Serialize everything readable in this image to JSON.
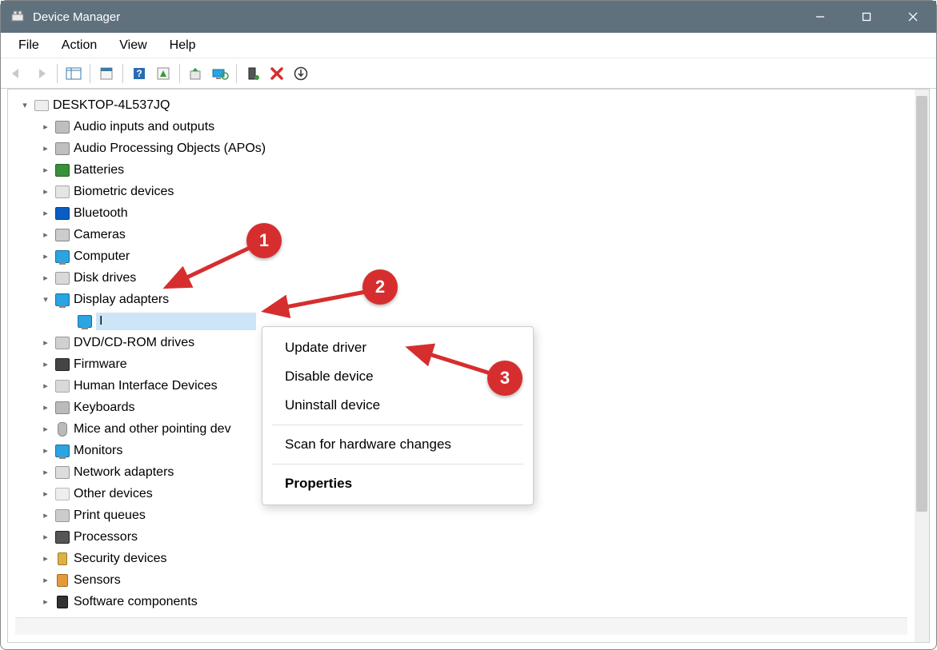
{
  "window": {
    "title": "Device Manager"
  },
  "menu": {
    "file": "File",
    "action": "Action",
    "view": "View",
    "help": "Help"
  },
  "toolbar": {
    "back": "Back",
    "forward": "Forward",
    "show_hide_tree": "Show/Hide Console Tree",
    "properties": "Properties",
    "help": "Help",
    "actions": "Actions",
    "update": "Update driver",
    "scan": "Scan for hardware changes",
    "enable": "Enable device",
    "disable": "Disable device",
    "uninstall": "Uninstall device",
    "add_legacy": "Add legacy hardware"
  },
  "tree": {
    "root": "DESKTOP-4L537JQ",
    "items": {
      "audio_io": "Audio inputs and outputs",
      "audio_apo": "Audio Processing Objects (APOs)",
      "batteries": "Batteries",
      "biometric": "Biometric devices",
      "bluetooth": "Bluetooth",
      "cameras": "Cameras",
      "computer": "Computer",
      "disk": "Disk drives",
      "display": "Display adapters",
      "display_child_placeholder": "I",
      "dvd": "DVD/CD-ROM drives",
      "firmware": "Firmware",
      "hid": "Human Interface Devices",
      "keyboards": "Keyboards",
      "mice": "Mice and other pointing dev",
      "monitors": "Monitors",
      "network": "Network adapters",
      "other": "Other devices",
      "print": "Print queues",
      "processors": "Processors",
      "security": "Security devices",
      "sensors": "Sensors",
      "software": "Software components"
    }
  },
  "context_menu": {
    "update": "Update driver",
    "disable": "Disable device",
    "uninstall": "Uninstall device",
    "scan": "Scan for hardware changes",
    "properties": "Properties"
  },
  "annotations": {
    "b1": "1",
    "b2": "2",
    "b3": "3"
  }
}
